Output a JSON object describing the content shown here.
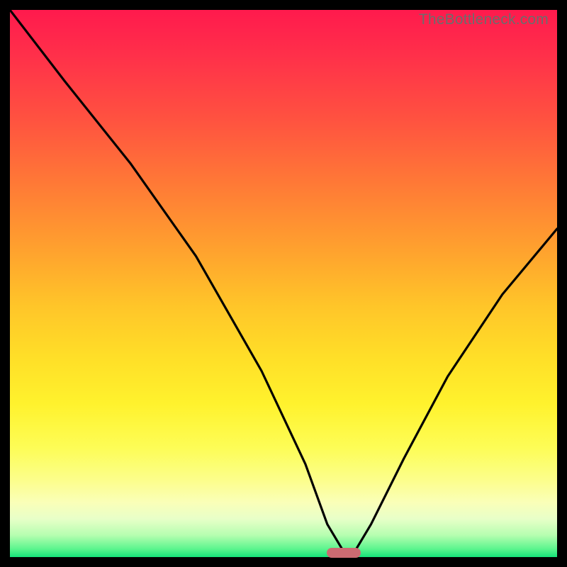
{
  "watermark": "TheBottleneck.com",
  "marker": {
    "x_pct": 60.5,
    "y_pct": 99.0
  },
  "chart_data": {
    "type": "line",
    "title": "",
    "xlabel": "",
    "ylabel": "",
    "xlim": [
      0,
      100
    ],
    "ylim": [
      0,
      100
    ],
    "series": [
      {
        "name": "bottleneck-curve",
        "x": [
          0,
          10,
          22,
          34,
          46,
          54,
          58,
          61,
          63,
          66,
          72,
          80,
          90,
          100
        ],
        "y": [
          100,
          87,
          72,
          55,
          34,
          17,
          6,
          1,
          1,
          6,
          18,
          33,
          48,
          60
        ]
      }
    ],
    "optimum_marker": {
      "x": 61,
      "y": 0.8
    }
  }
}
